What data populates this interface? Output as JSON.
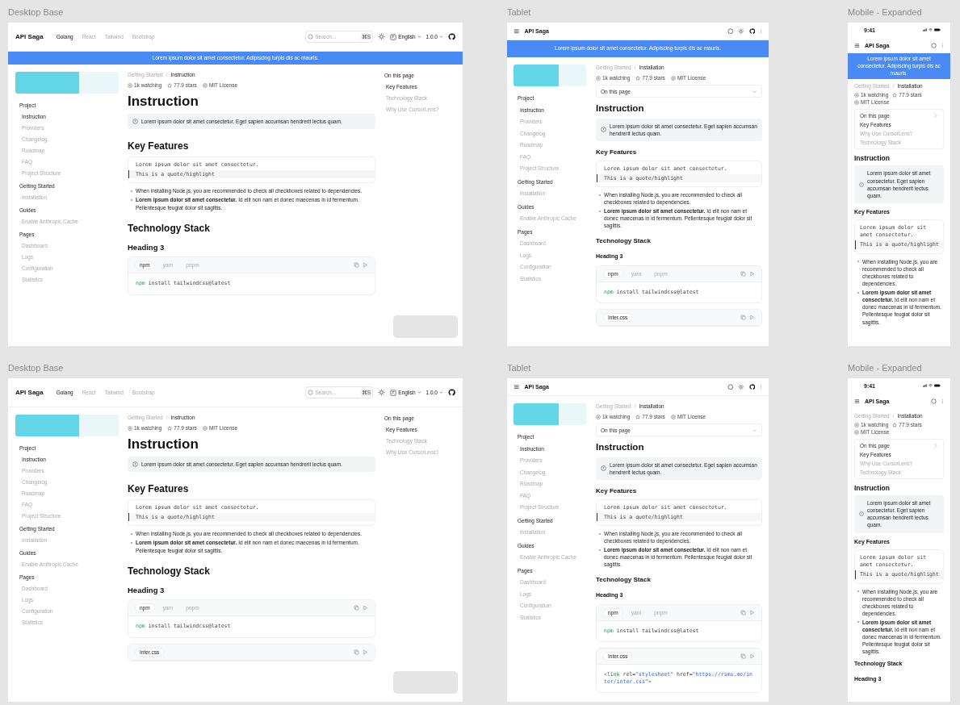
{
  "frames": [
    {
      "label": "Desktop Base",
      "kind": "desktop",
      "header": {
        "logo": "API Saga",
        "nav": [
          {
            "label": "Golang",
            "selected": true
          },
          {
            "label": "React",
            "selected": false
          },
          {
            "label": "Tailwind",
            "selected": false
          },
          {
            "label": "Bootstrap",
            "selected": false
          }
        ],
        "search": {
          "placeholder": "Search...",
          "shortcut": "⌘S"
        },
        "language": "English",
        "version": "1.0.0"
      },
      "banner": "Lorem ipsum dolor sit amet consectetur. Adipiscing turpis dis ac mauris.",
      "sidebar": [
        {
          "title": "Project",
          "items": [
            {
              "label": "Instruction",
              "selected": true
            },
            {
              "label": "Providers",
              "selected": false
            },
            {
              "label": "Changelog",
              "selected": false
            },
            {
              "label": "Roadmap",
              "selected": false
            },
            {
              "label": "FAQ",
              "selected": false
            },
            {
              "label": "Project Structure",
              "selected": false
            }
          ]
        },
        {
          "title": "Getting Started",
          "items": [
            {
              "label": "Installation",
              "selected": false
            }
          ]
        },
        {
          "title": "Guides",
          "items": [
            {
              "label": "Enable Anthropic Cache",
              "selected": false
            }
          ]
        },
        {
          "title": "Pages",
          "items": [
            {
              "label": "Dashboard",
              "selected": false
            },
            {
              "label": "Logs",
              "selected": false
            },
            {
              "label": "Configuration",
              "selected": false
            },
            {
              "label": "Statistics",
              "selected": false
            }
          ]
        }
      ],
      "breadcrumb": {
        "items": [
          "Getting Started",
          "Instruction"
        ],
        "separator": "/"
      },
      "meta": [
        {
          "kind": "watchers",
          "text": "1k watching"
        },
        {
          "kind": "stars",
          "text": "77.9 stars"
        },
        {
          "kind": "license",
          "text": "MIT License"
        }
      ],
      "toc": {
        "title": "On this page",
        "items": [
          {
            "label": "Key Features",
            "selected": true
          },
          {
            "label": "Technology Stack",
            "selected": false
          },
          {
            "label": "Why Use CursorLens?",
            "selected": false
          }
        ]
      },
      "content": [
        {
          "kind": "h1",
          "text": "Instruction"
        },
        {
          "kind": "callout",
          "text": "Lorem ipsum dolor sit amet consectetur. Eget sapien accumsan hendrerit lectus quam."
        },
        {
          "kind": "h2",
          "text": "Key Features"
        },
        {
          "kind": "quote",
          "text": "Lorem ipsum dolor sit amet consectetur.",
          "highlight": "This is a quote/highlight"
        },
        {
          "kind": "list",
          "items": [
            "When installing Node.js, you are recommended to check all checkboxes related to dependencies.",
            "**Lorem ipsum dolor sit amet consectetur.** Id elit non nam et donec maecenas in id fermentum. Pellentesque feugiat dolor sit sagittis."
          ]
        },
        {
          "kind": "h2",
          "text": "Technology Stack"
        },
        {
          "kind": "h3",
          "text": "Heading 3"
        },
        {
          "kind": "code_tabs",
          "tabs": [
            {
              "label": "npm",
              "selected": true
            },
            {
              "label": "yarn",
              "selected": false
            },
            {
              "label": "pnpm",
              "selected": false
            }
          ],
          "code": [
            {
              "kind": "keyword",
              "text": "npm"
            },
            {
              "kind": "plain",
              "text": " install tailwindcss@latest"
            }
          ]
        }
      ]
    },
    {
      "label": "Tablet",
      "kind": "tablet",
      "header": {
        "logo": "API Saga"
      },
      "banner": "Lorem ipsum dolor sit amet consectetur. Adipiscing turpis dis ac mauris.",
      "sidebar": [
        {
          "title": "Project",
          "items": [
            {
              "label": "Instruction",
              "selected": true
            },
            {
              "label": "Providers",
              "selected": false
            },
            {
              "label": "Changelog",
              "selected": false
            },
            {
              "label": "Roadmap",
              "selected": false
            },
            {
              "label": "FAQ",
              "selected": false
            },
            {
              "label": "Project Structure",
              "selected": false
            }
          ]
        },
        {
          "title": "Getting Started",
          "items": [
            {
              "label": "Installation",
              "selected": false
            }
          ]
        },
        {
          "title": "Guides",
          "items": [
            {
              "label": "Enable Anthropic Cache",
              "selected": false
            }
          ]
        },
        {
          "title": "Pages",
          "items": [
            {
              "label": "Dashboard",
              "selected": false
            },
            {
              "label": "Logs",
              "selected": false
            },
            {
              "label": "Configuration",
              "selected": false
            },
            {
              "label": "Statistics",
              "selected": false
            }
          ]
        }
      ],
      "breadcrumb": {
        "items": [
          "Getting Started",
          "Installation"
        ],
        "separator": "/"
      },
      "meta": [
        {
          "kind": "watchers",
          "text": "1k watching"
        },
        {
          "kind": "stars",
          "text": "77.9 stars"
        },
        {
          "kind": "license",
          "text": "MIT License"
        }
      ],
      "toc": {
        "title": "On this page"
      },
      "content": [
        {
          "kind": "h1",
          "text": "Instruction"
        },
        {
          "kind": "callout",
          "text": "Lorem ipsum dolor sit amet consectetur. Eget sapien accumsan hendrerit lectus quam."
        },
        {
          "kind": "h2",
          "text": "Key Features"
        },
        {
          "kind": "quote",
          "text": "Lorem ipsum dolor sit amet consectetur.",
          "highlight": "This is a quote/highlight"
        },
        {
          "kind": "list",
          "items": [
            "When installing Node.js, you are recommended to check all checkboxes related to dependencies.",
            "**Lorem ipsum dolor sit amet consectetur.** Id elit non nam et donec maecenas in id fermentum. Pellentesque feugiat dolor sit sagittis."
          ]
        },
        {
          "kind": "h2",
          "text": "Technology Stack"
        },
        {
          "kind": "h3",
          "text": "Heading 3"
        },
        {
          "kind": "code_tabs",
          "tabs": [
            {
              "label": "npm",
              "selected": true
            },
            {
              "label": "yarn",
              "selected": false
            },
            {
              "label": "pnpm",
              "selected": false
            }
          ],
          "code": [
            {
              "kind": "keyword",
              "text": "npm"
            },
            {
              "kind": "plain",
              "text": " install tailwindcss@latest"
            }
          ]
        },
        {
          "kind": "code_file",
          "file": "Inter.css"
        }
      ]
    },
    {
      "label": "Mobile - Expanded",
      "kind": "mobile",
      "status_bar": {
        "time": "9:41"
      },
      "header": {
        "logo": "API Saga"
      },
      "banner": "Lorem ipsum dolor sit amet consectetur. Adipiscing turpis dis ac mauris.",
      "breadcrumb": {
        "items": [
          "Getting Started",
          "Installation"
        ],
        "separator": "/"
      },
      "meta": [
        {
          "kind": "watchers",
          "text": "1k watching"
        },
        {
          "kind": "stars",
          "text": "77.9 stars"
        },
        {
          "kind": "license",
          "text": "MIT License"
        }
      ],
      "toc": {
        "title": "On this page",
        "items": [
          {
            "label": "Key Features",
            "selected": true
          },
          {
            "label": "Why Use CursorLens?",
            "selected": false
          },
          {
            "label": "Technology Stack",
            "selected": false
          }
        ]
      },
      "content": [
        {
          "kind": "h1",
          "text": "Instruction"
        },
        {
          "kind": "callout",
          "text": "Lorem ipsum dolor sit amet consectetur. Eget sapien accumsan hendrerit lectus quam."
        },
        {
          "kind": "h2",
          "text": "Key Features"
        },
        {
          "kind": "quote",
          "text": "Lorem ipsum dolor sit amet consectetur.",
          "highlight": "This is a quote/highlight"
        },
        {
          "kind": "list",
          "items": [
            "When installing Node.js, you are recommended to check all checkboxes related to dependencies.",
            "**Lorem ipsum dolor sit amet consectetur.** Id elit non nam et donec maecenas in id fermentum. Pellentesque feugiat dolor sit sagittis."
          ]
        }
      ]
    },
    {
      "label": "Desktop Base",
      "kind": "desktop",
      "header": {
        "logo": "API Saga",
        "nav": [
          {
            "label": "Golang",
            "selected": true
          },
          {
            "label": "React",
            "selected": false
          },
          {
            "label": "Tailwind",
            "selected": false
          },
          {
            "label": "Bootstrap",
            "selected": false
          }
        ],
        "search": {
          "placeholder": "Search...",
          "shortcut": "⌘S"
        },
        "language": "English",
        "version": "1.0.0"
      },
      "sidebar": [
        {
          "title": "Project",
          "items": [
            {
              "label": "Instruction",
              "selected": true
            },
            {
              "label": "Providers",
              "selected": false
            },
            {
              "label": "Changelog",
              "selected": false
            },
            {
              "label": "Roadmap",
              "selected": false
            },
            {
              "label": "FAQ",
              "selected": false
            },
            {
              "label": "Project Structure",
              "selected": false
            }
          ]
        },
        {
          "title": "Getting Started",
          "items": [
            {
              "label": "Installation",
              "selected": false
            }
          ]
        },
        {
          "title": "Guides",
          "items": [
            {
              "label": "Enable Anthropic Cache",
              "selected": false
            }
          ]
        },
        {
          "title": "Pages",
          "items": [
            {
              "label": "Dashboard",
              "selected": false
            },
            {
              "label": "Logs",
              "selected": false
            },
            {
              "label": "Configuration",
              "selected": false
            },
            {
              "label": "Statistics",
              "selected": false
            }
          ]
        }
      ],
      "breadcrumb": {
        "items": [
          "Getting Started",
          "Instruction"
        ],
        "separator": "/"
      },
      "meta": [
        {
          "kind": "watchers",
          "text": "1k watching"
        },
        {
          "kind": "stars",
          "text": "77.9 stars"
        },
        {
          "kind": "license",
          "text": "MIT License"
        }
      ],
      "toc": {
        "title": "On this page",
        "items": [
          {
            "label": "Key Features",
            "selected": true
          },
          {
            "label": "Technology Stack",
            "selected": false
          },
          {
            "label": "Why Use CursorLens?",
            "selected": false
          }
        ]
      },
      "content": [
        {
          "kind": "h1",
          "text": "Instruction"
        },
        {
          "kind": "callout",
          "text": "Lorem ipsum dolor sit amet consectetur. Eget sapien accumsan hendrerit lectus quam."
        },
        {
          "kind": "h2",
          "text": "Key Features"
        },
        {
          "kind": "quote",
          "text": "Lorem ipsum dolor sit amet consectetur.",
          "highlight": "This is a quote/highlight"
        },
        {
          "kind": "list",
          "items": [
            "When installing Node.js, you are recommended to check all checkboxes related to dependencies.",
            "**Lorem ipsum dolor sit amet consectetur.** Id elit non nam et donec maecenas in id fermentum. Pellentesque feugiat dolor sit sagittis."
          ]
        },
        {
          "kind": "h2",
          "text": "Technology Stack"
        },
        {
          "kind": "h3",
          "text": "Heading 3"
        },
        {
          "kind": "code_tabs",
          "tabs": [
            {
              "label": "npm",
              "selected": true
            },
            {
              "label": "yarn",
              "selected": false
            },
            {
              "label": "pnpm",
              "selected": false
            }
          ],
          "code": [
            {
              "kind": "keyword",
              "text": "npm"
            },
            {
              "kind": "plain",
              "text": " install tailwindcss@latest"
            }
          ]
        },
        {
          "kind": "code_file",
          "file": "Inter.css"
        }
      ]
    },
    {
      "label": "Tablet",
      "kind": "tablet",
      "header": {
        "logo": "API Saga"
      },
      "sidebar": [
        {
          "title": "Project",
          "items": [
            {
              "label": "Instruction",
              "selected": true
            },
            {
              "label": "Providers",
              "selected": false
            },
            {
              "label": "Changelog",
              "selected": false
            },
            {
              "label": "Roadmap",
              "selected": false
            },
            {
              "label": "FAQ",
              "selected": false
            },
            {
              "label": "Project Structure",
              "selected": false
            }
          ]
        },
        {
          "title": "Getting Started",
          "items": [
            {
              "label": "Installation",
              "selected": false
            }
          ]
        },
        {
          "title": "Guides",
          "items": [
            {
              "label": "Enable Anthropic Cache",
              "selected": false
            }
          ]
        },
        {
          "title": "Pages",
          "items": [
            {
              "label": "Dashboard",
              "selected": false
            },
            {
              "label": "Logs",
              "selected": false
            },
            {
              "label": "Configuration",
              "selected": false
            },
            {
              "label": "Statistics",
              "selected": false
            }
          ]
        }
      ],
      "breadcrumb": {
        "items": [
          "Getting Started",
          "Installation"
        ],
        "separator": "/"
      },
      "meta": [
        {
          "kind": "watchers",
          "text": "1k watching"
        },
        {
          "kind": "stars",
          "text": "77.9 stars"
        },
        {
          "kind": "license",
          "text": "MIT License"
        }
      ],
      "toc": {
        "title": "On this page"
      },
      "content": [
        {
          "kind": "h1",
          "text": "Instruction"
        },
        {
          "kind": "callout",
          "text": "Lorem ipsum dolor sit amet consectetur. Eget sapien accumsan hendrerit lectus quam."
        },
        {
          "kind": "h2",
          "text": "Key Features"
        },
        {
          "kind": "quote",
          "text": "Lorem ipsum dolor sit amet consectetur.",
          "highlight": "This is a quote/highlight"
        },
        {
          "kind": "list",
          "items": [
            "When installing Node.js, you are recommended to check all checkboxes related to dependencies.",
            "**Lorem ipsum dolor sit amet consectetur.** Id elit non nam et donec maecenas in id fermentum. Pellentesque feugiat dolor sit sagittis."
          ]
        },
        {
          "kind": "h2",
          "text": "Technology Stack"
        },
        {
          "kind": "h3",
          "text": "Heading 3"
        },
        {
          "kind": "code_tabs",
          "tabs": [
            {
              "label": "npm",
              "selected": true
            },
            {
              "label": "yarn",
              "selected": false
            },
            {
              "label": "pnpm",
              "selected": false
            }
          ],
          "code": [
            {
              "kind": "keyword",
              "text": "npm"
            },
            {
              "kind": "plain",
              "text": " install tailwindcss@latest"
            }
          ]
        },
        {
          "kind": "code_file",
          "file": "Inter.css",
          "code": [
            {
              "kind": "tag",
              "text": "<link"
            },
            {
              "kind": "plain",
              "text": " rel="
            },
            {
              "kind": "string",
              "text": "\"stylesheet\""
            },
            {
              "kind": "plain",
              "text": " href="
            },
            {
              "kind": "string",
              "text": "\"https://rsms.me/inter/inter.css\""
            },
            {
              "kind": "tag",
              "text": ">"
            }
          ]
        }
      ]
    },
    {
      "label": "Mobile - Expanded",
      "kind": "mobile",
      "status_bar": {
        "time": "9:41"
      },
      "header": {
        "logo": "API Saga"
      },
      "breadcrumb": {
        "items": [
          "Getting Started",
          "Installation"
        ],
        "separator": "/"
      },
      "meta": [
        {
          "kind": "watchers",
          "text": "1k watching"
        },
        {
          "kind": "stars",
          "text": "77.9 stars"
        },
        {
          "kind": "license",
          "text": "MIT License"
        }
      ],
      "toc": {
        "title": "On this page",
        "items": [
          {
            "label": "Key Features",
            "selected": true
          },
          {
            "label": "Why Use CursorLens?",
            "selected": false
          },
          {
            "label": "Technology Stack",
            "selected": false
          }
        ]
      },
      "content": [
        {
          "kind": "h1",
          "text": "Instruction"
        },
        {
          "kind": "callout",
          "text": "Lorem ipsum dolor sit amet consectetur. Eget sapien accumsan hendrerit lectus quam."
        },
        {
          "kind": "h2",
          "text": "Key Features"
        },
        {
          "kind": "quote",
          "text": "Lorem ipsum dolor sit amet consectetur.",
          "highlight": "This is a quote/highlight"
        },
        {
          "kind": "list",
          "items": [
            "When installing Node.js, you are recommended to check all checkboxes related to dependencies.",
            "**Lorem ipsum dolor sit amet consectetur.** Id elit non nam et donec maecenas in id fermentum. Pellentesque feugiat dolor sit sagittis."
          ]
        },
        {
          "kind": "h2",
          "text": "Technology Stack"
        },
        {
          "kind": "h3",
          "text": "Heading 3"
        }
      ]
    }
  ]
}
